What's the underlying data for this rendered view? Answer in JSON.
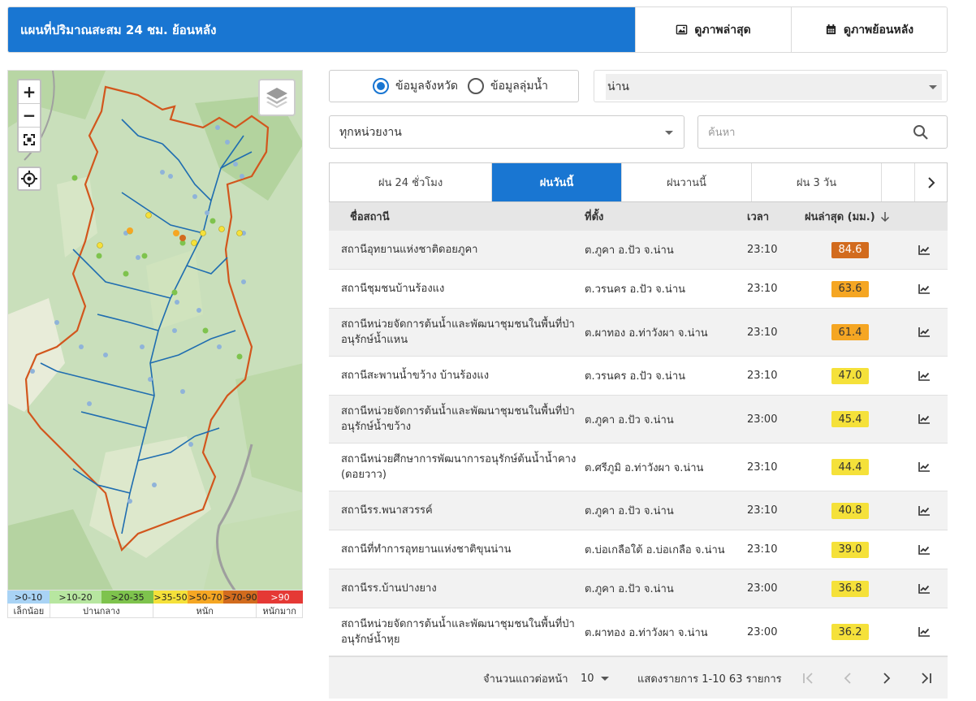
{
  "header": {
    "title": "แผนที่ปริมาณสะสม 24 ชม. ย้อนหลัง",
    "btn_latest": "ดูภาพล่าสุด",
    "btn_history": "ดูภาพย้อนหลัง"
  },
  "map": {
    "zoom_in": "+",
    "zoom_out": "−",
    "legend_bands": [
      {
        "label": ">0-10",
        "color": "#a9d3f5"
      },
      {
        "label": ">10-20",
        "color": "#b7e6a0"
      },
      {
        "label": ">20-35",
        "color": "#7ec34d"
      },
      {
        "label": ">35-50",
        "color": "#f5e13a"
      },
      {
        "label": ">50-70",
        "color": "#f5a623"
      },
      {
        "label": ">70-90",
        "color": "#d26b1e"
      },
      {
        "label": ">90",
        "color": "#e53935"
      }
    ],
    "legend_cats": [
      "เล็กน้อย",
      "ปานกลาง",
      "หนัก",
      "หนักมาก"
    ]
  },
  "filters": {
    "radio_province": "ข้อมูลจังหวัด",
    "radio_basin": "ข้อมูลลุ่มน้ำ",
    "province": "น่าน",
    "agency": "ทุกหน่วยงาน",
    "search_placeholder": "ค้นหา"
  },
  "tabs": [
    "ฝน 24 ชั่วโมง",
    "ฝนวันนี้",
    "ฝนวานนี้",
    "ฝน 3 วัน"
  ],
  "table": {
    "headers": {
      "name": "ชื่อสถานี",
      "location": "ที่ตั้ง",
      "time": "เวลา",
      "rain": "ฝนล่าสุด (มม.)"
    },
    "rows": [
      {
        "name": "สถานีอุทยานแห่งชาติดอยภูคา",
        "location": "ต.ภูคา อ.ปัว จ.น่าน",
        "time": "23:10",
        "value": "84.6"
      },
      {
        "name": "สถานีชุมชนบ้านร้องแง",
        "location": "ต.วรนคร อ.ปัว จ.น่าน",
        "time": "23:10",
        "value": "63.6"
      },
      {
        "name": "สถานีหน่วยจัดการต้นน้ำและพัฒนาชุมชนในพื้นที่ป่าอนุรักษ์น้ำแหน",
        "location": "ต.ผาทอง อ.ท่าวังผา จ.น่าน",
        "time": "23:10",
        "value": "61.4"
      },
      {
        "name": "สถานีสะพานน้ำขว้าง บ้านร้องแง",
        "location": "ต.วรนคร อ.ปัว จ.น่าน",
        "time": "23:10",
        "value": "47.0"
      },
      {
        "name": "สถานีหน่วยจัดการต้นน้ำและพัฒนาชุมชนในพื้นที่ป่าอนุรักษ์น้ำขว้าง",
        "location": "ต.ภูคา อ.ปัว จ.น่าน",
        "time": "23:00",
        "value": "45.4"
      },
      {
        "name": "สถานีหน่วยศึกษาการพัฒนาการอนุรักษ์ต้นน้ำน้ำคาง (ดอยวาว)",
        "location": "ต.ศรีภูมิ อ.ท่าวังผา จ.น่าน",
        "time": "23:10",
        "value": "44.4"
      },
      {
        "name": "สถานีรร.พนาสวรรค์",
        "location": "ต.ภูคา อ.ปัว จ.น่าน",
        "time": "23:10",
        "value": "40.8"
      },
      {
        "name": "สถานีที่ทำการอุทยานแห่งชาติขุนน่าน",
        "location": "ต.บ่อเกลือใต้ อ.บ่อเกลือ จ.น่าน",
        "time": "23:10",
        "value": "39.0"
      },
      {
        "name": "สถานีรร.บ้านปางยาง",
        "location": "ต.ภูคา อ.ปัว จ.น่าน",
        "time": "23:00",
        "value": "36.8"
      },
      {
        "name": "สถานีหน่วยจัดการต้นน้ำและพัฒนาชุมชนในพื้นที่ป่าอนุรักษ์น้ำหุย",
        "location": "ต.ผาทอง อ.ท่าวังผา จ.น่าน",
        "time": "23:00",
        "value": "36.2"
      }
    ],
    "value_colors": {
      "orange_dark": "#d26b1e",
      "orange": "#f5a623",
      "yellow": "#f5e13a"
    }
  },
  "pagination": {
    "rows_per_page_label": "จำนวนแถวต่อหน้า",
    "rows_per_page": "10",
    "range_text": "แสดงรายการ 1-10 63 รายการ"
  },
  "icons": [
    "image-icon",
    "calendar-icon",
    "search-icon",
    "chart-icon",
    "layers-icon",
    "locate-icon",
    "fullscreen-icon",
    "sort-arrow-icon"
  ]
}
